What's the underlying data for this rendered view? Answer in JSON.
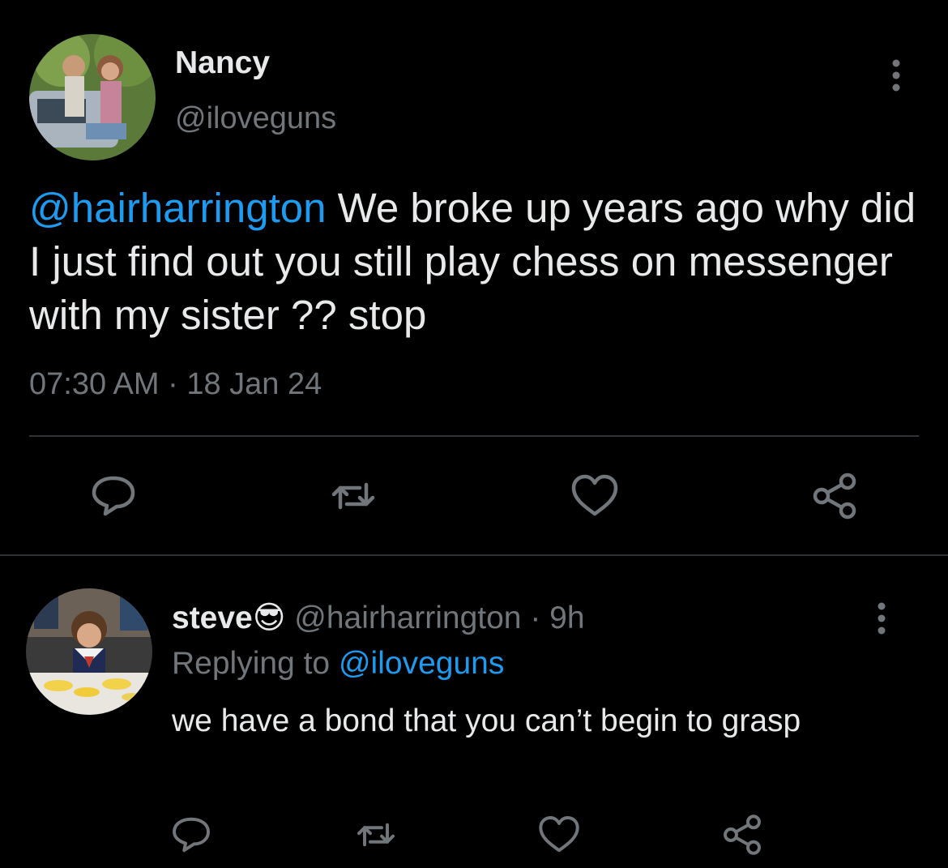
{
  "main_tweet": {
    "display_name": "Nancy",
    "handle": "@iloveguns",
    "mention": "@hairharrington",
    "text": " We broke up years ago why did I just find out you still play chess on messenger with my sister ?? stop",
    "timestamp": "07:30 AM · 18 Jan 24"
  },
  "reply": {
    "display_name": "steve",
    "emoji": "😎",
    "meta": "@hairharrington · 9h",
    "replying_prefix": "Replying to ",
    "replying_handle": "@iloveguns",
    "text": "we have a bond that you can’t begin to grasp"
  },
  "icons": [
    "more-icon",
    "reply-icon",
    "retweet-icon",
    "like-icon",
    "share-icon"
  ],
  "colors": {
    "background": "#000000",
    "text_primary": "#e7e9ea",
    "text_secondary": "#71767b",
    "accent": "#1d9bf0",
    "divider": "#2f3336"
  }
}
